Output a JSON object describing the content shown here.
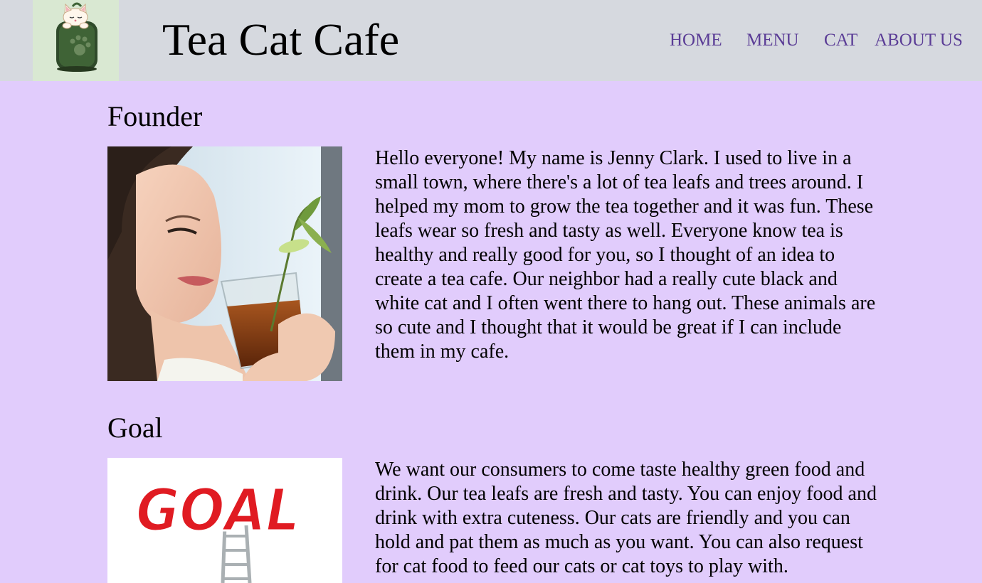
{
  "header": {
    "title": "Tea Cat Cafe",
    "logo_icon": "tea-cat-logo-icon",
    "nav": [
      {
        "label": "HOME"
      },
      {
        "label": "MENU"
      },
      {
        "label": "CAT"
      },
      {
        "label": "ABOUT US"
      }
    ]
  },
  "sections": [
    {
      "heading": "Founder",
      "image_icon": "founder-photo",
      "text": "Hello everyone! My name is Jenny Clark. I used to live in a small town, where there's a lot of tea leafs and trees around. I helped my mom to grow the tea together and it was fun. These leafs wear so fresh and tasty as well. Everyone know tea is healthy and really good for you, so I thought of an idea to create a tea cafe. Our neighbor had a really cute black and white cat and I often went there to hang out. These animals are so cute and I thought that it would be great if I can include them in my cafe."
    },
    {
      "heading": "Goal",
      "image_icon": "goal-ladder-image",
      "image_text": "GOAL",
      "text": "We want our consumers to come taste healthy green food and drink. Our tea leafs are fresh and tasty. You can enjoy food and drink with extra cuteness. Our cats are friendly and you can hold and pat them as much as you want. You can also request for cat food to feed our cats or cat toys to play with."
    }
  ],
  "colors": {
    "page_background": "#e1ccfc",
    "header_background": "#d6d9df",
    "nav_link": "#5b3d96"
  }
}
